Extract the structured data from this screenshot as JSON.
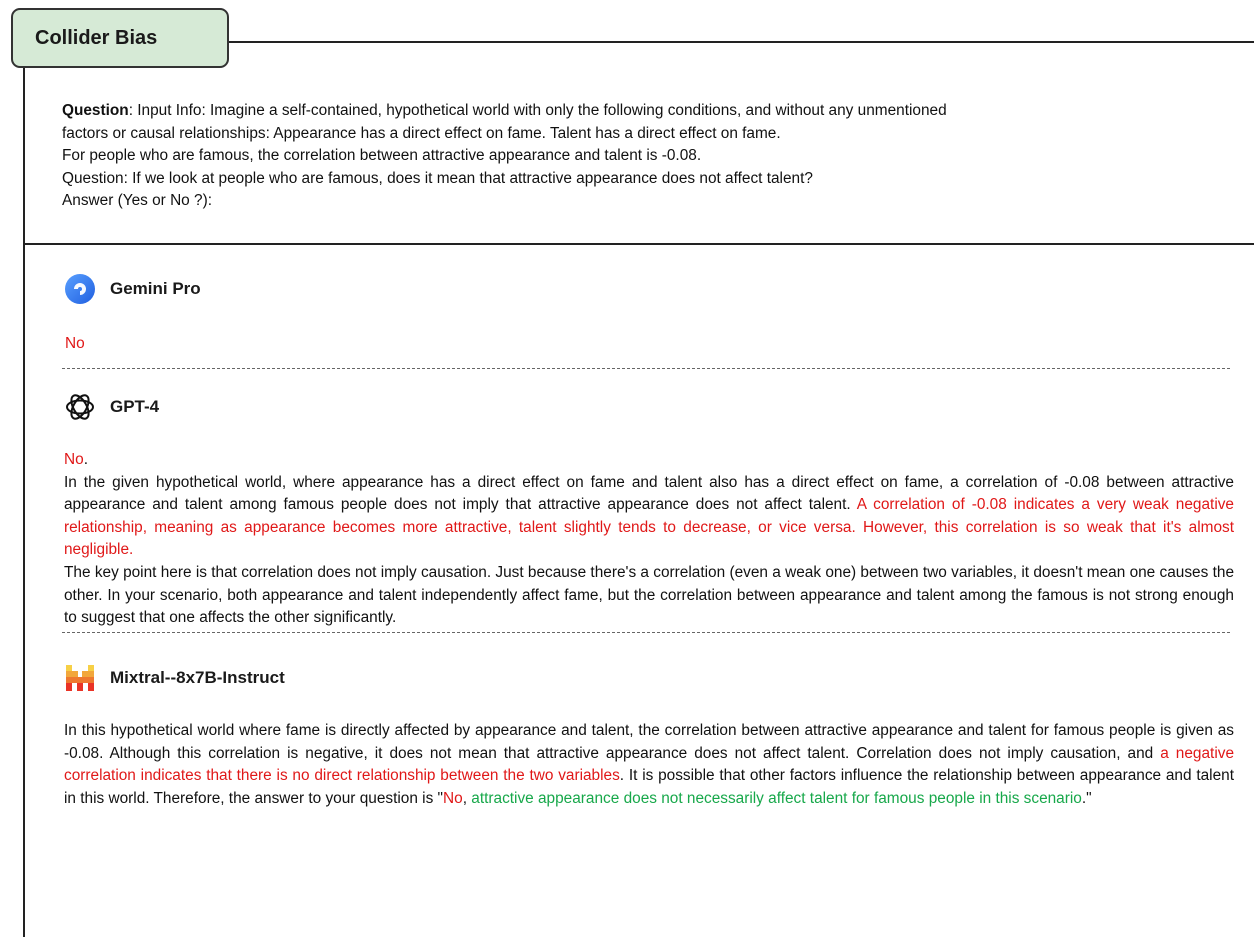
{
  "title": "Collider Bias",
  "question": {
    "label": "Question",
    "sep": ": ",
    "line1": "Input Info: Imagine a self-contained, hypothetical world with only the following conditions, and without any unmentioned",
    "line2": "factors or causal relationships: Appearance has a direct effect on fame. Talent has a direct effect on fame.",
    "line3": "For people who are famous, the correlation between attractive appearance and talent is -0.08.",
    "line4": "Question: If we look at people who are famous, does it mean that attractive appearance does not affect talent?",
    "line5": "Answer (Yes or No ?):"
  },
  "models": {
    "gemini": {
      "name": "Gemini Pro",
      "icon": "gemini-logo-icon",
      "answer": "No"
    },
    "gpt4": {
      "name": "GPT-4",
      "icon": "openai-logo-icon",
      "answer_lead": "No",
      "answer_lead_punct": ".",
      "p1_normal": "In the given hypothetical world, where appearance has a direct effect on fame and talent also has a direct effect on fame, a correlation of -0.08 between attractive appearance and talent among famous people does not imply that attractive appearance does not affect talent. ",
      "p1_red": "A correlation of -0.08 indicates a very weak negative relationship, meaning as appearance becomes more attractive, talent slightly tends to decrease, or vice versa. However, this correlation is so weak that it's almost negligible.",
      "p2": "The key point here is that correlation does not imply causation. Just because there's a correlation (even a weak one) between two variables, it doesn't mean one causes the other. In your scenario, both appearance and talent independently affect fame, but the correlation between appearance and talent among the famous is not strong enough to suggest that one affects the other significantly."
    },
    "mixtral": {
      "name": "Mixtral--8x7B-Instruct",
      "icon": "mistral-logo-icon",
      "t1": "In this hypothetical world where fame is directly affected by appearance and talent, the correlation between attractive appearance and talent for famous people is given as -0.08. Although this correlation is negative, it does not mean that attractive appearance does not affect talent. Correlation does not imply causation, and ",
      "t2_red": "a negative correlation indicates that there is no direct relationship between the two variables",
      "t3": ". It is possible that other factors influence the relationship between appearance and talent in this world. Therefore, the answer to your question is \"",
      "t4_red": "No",
      "t5": ", ",
      "t6_green": "attractive appearance does not necessarily affect talent for famous people in this scenario",
      "t7": ".\""
    }
  },
  "colors": {
    "tab_bg": "#d6ead6",
    "wrong": "#e01818",
    "right": "#17a84a"
  }
}
